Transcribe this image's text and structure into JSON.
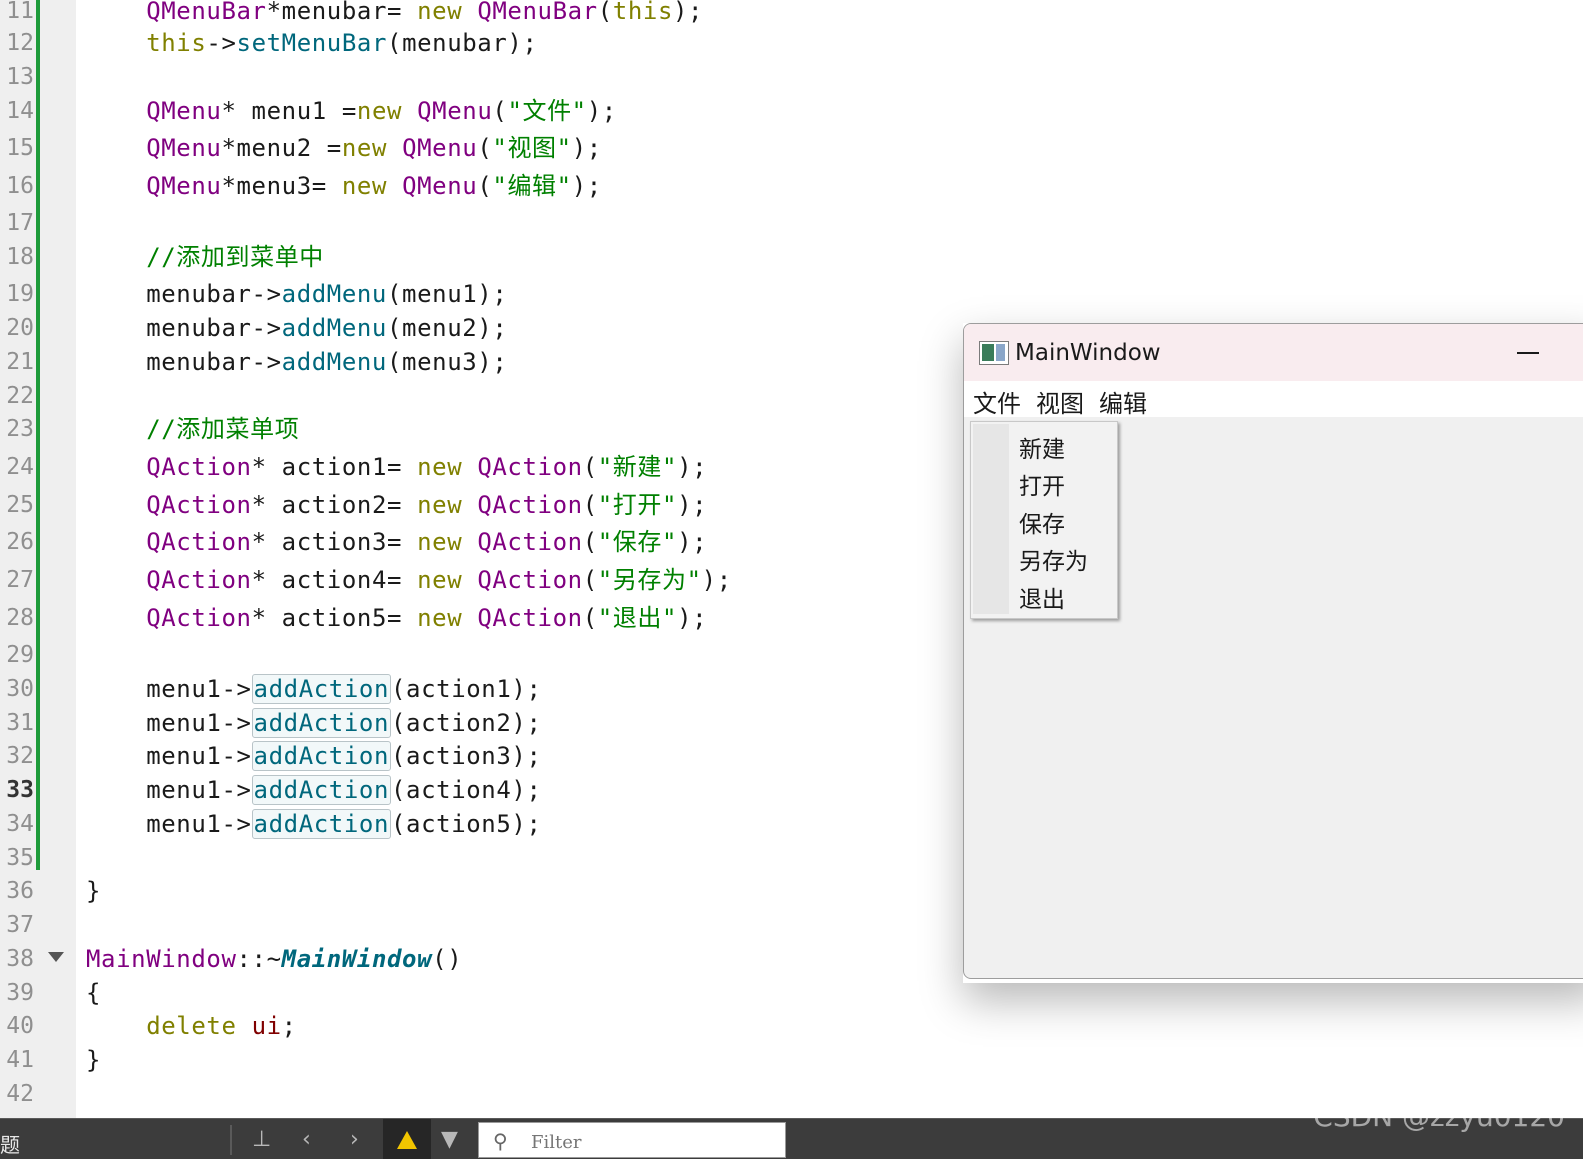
{
  "editor": {
    "line_numbers": [
      "11",
      "12",
      "13",
      "14",
      "15",
      "16",
      "17",
      "18",
      "19",
      "20",
      "21",
      "22",
      "23",
      "24",
      "25",
      "26",
      "27",
      "28",
      "29",
      "30",
      "31",
      "32",
      "33",
      "34",
      "35",
      "36",
      "37",
      "38",
      "39",
      "40",
      "41",
      "42"
    ],
    "current_line": "33",
    "code": {
      "l11": {
        "a": "    ",
        "b": "QMenuBar",
        "c": "*menubar= ",
        "d": "new",
        "e": " ",
        "f": "QMenuBar",
        "g": "(",
        "h": "this",
        "i": ");"
      },
      "l12": {
        "a": "    ",
        "b": "this",
        "c": "->",
        "d": "setMenuBar",
        "e": "(menubar);"
      },
      "l14": {
        "a": "    ",
        "b": "QMenu",
        "c": "* menu1 =",
        "d": "new",
        "e": " ",
        "f": "QMenu",
        "g": "(",
        "h": "\"文件\"",
        "i": ");"
      },
      "l15": {
        "a": "    ",
        "b": "QMenu",
        "c": "*menu2 =",
        "d": "new",
        "e": " ",
        "f": "QMenu",
        "g": "(",
        "h": "\"视图\"",
        "i": ");"
      },
      "l16": {
        "a": "    ",
        "b": "QMenu",
        "c": "*menu3= ",
        "d": "new",
        "e": " ",
        "f": "QMenu",
        "g": "(",
        "h": "\"编辑\"",
        "i": ");"
      },
      "l18": {
        "a": "    ",
        "b": "//添加到菜单中"
      },
      "l19": {
        "a": "    menubar->",
        "b": "addMenu",
        "c": "(menu1);"
      },
      "l20": {
        "a": "    menubar->",
        "b": "addMenu",
        "c": "(menu2);"
      },
      "l21": {
        "a": "    menubar->",
        "b": "addMenu",
        "c": "(menu3);"
      },
      "l23": {
        "a": "    ",
        "b": "//添加菜单项"
      },
      "l24": {
        "a": "    ",
        "b": "QAction",
        "c": "* action1= ",
        "d": "new",
        "e": " ",
        "f": "QAction",
        "g": "(",
        "h": "\"新建\"",
        "i": ");"
      },
      "l25": {
        "a": "    ",
        "b": "QAction",
        "c": "* action2= ",
        "d": "new",
        "e": " ",
        "f": "QAction",
        "g": "(",
        "h": "\"打开\"",
        "i": ");"
      },
      "l26": {
        "a": "    ",
        "b": "QAction",
        "c": "* action3= ",
        "d": "new",
        "e": " ",
        "f": "QAction",
        "g": "(",
        "h": "\"保存\"",
        "i": ");"
      },
      "l27": {
        "a": "    ",
        "b": "QAction",
        "c": "* action4= ",
        "d": "new",
        "e": " ",
        "f": "QAction",
        "g": "(",
        "h": "\"另存为\"",
        "i": ");"
      },
      "l28": {
        "a": "    ",
        "b": "QAction",
        "c": "* action5= ",
        "d": "new",
        "e": " ",
        "f": "QAction",
        "g": "(",
        "h": "\"退出\"",
        "i": ");"
      },
      "l30": {
        "a": "    menu1->",
        "b": "addAction",
        "c": "(action1);"
      },
      "l31": {
        "a": "    menu1->",
        "b": "addAction",
        "c": "(action2);"
      },
      "l32": {
        "a": "    menu1->",
        "b": "addAction",
        "c": "(action3);"
      },
      "l33": {
        "a": "    menu1->",
        "b": "addAction",
        "c": "(action4);"
      },
      "l34": {
        "a": "    menu1->",
        "b": "addAction",
        "c": "(action5);"
      },
      "l36": {
        "a": "}"
      },
      "l38": {
        "a": "MainWindow",
        "b": "::~",
        "c": "MainWindow",
        "d": "()"
      },
      "l39": {
        "a": "{"
      },
      "l40": {
        "a": "    ",
        "b": "delete",
        "c": " ",
        "d": "ui",
        "e": ";"
      },
      "l41": {
        "a": "}"
      }
    }
  },
  "main_window": {
    "title": "MainWindow",
    "menus": [
      "文件",
      "视图",
      "编辑"
    ],
    "dropdown_items": [
      "新建",
      "打开",
      "保存",
      "另存为",
      "退出"
    ]
  },
  "bottom_panel": {
    "tab_label": "题",
    "filter_placeholder": "Filter"
  },
  "watermark": "CSDN @zzyu0120",
  "colors": {
    "type": "#800080",
    "keyword": "#808000",
    "function": "#00677c",
    "string": "#008000",
    "comment": "#008000",
    "gutter_change_marker": "#1e9b3a",
    "warning": "#f2c500"
  }
}
